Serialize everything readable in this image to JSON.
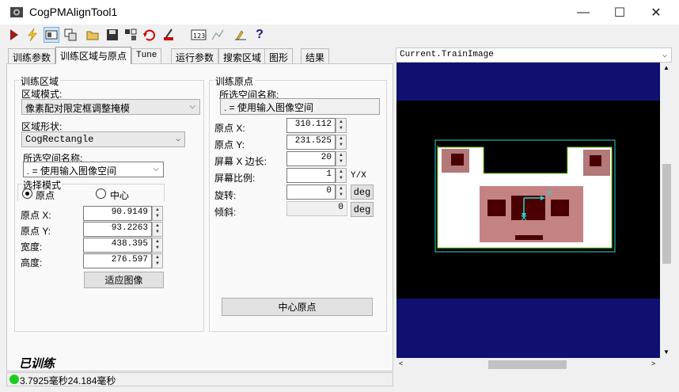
{
  "window": {
    "title": "CogPMAlignTool1",
    "min_glyph": "—",
    "max_glyph": "☐",
    "close_glyph": "✕"
  },
  "tabs": [
    {
      "label": "训练参数"
    },
    {
      "label": "训练区域与原点"
    },
    {
      "label": "Tune"
    },
    {
      "label": "运行参数"
    },
    {
      "label": "搜索区域"
    },
    {
      "label": "图形"
    },
    {
      "label": "结果"
    }
  ],
  "region": {
    "group_title": "训练区域",
    "mode_label": "区域模式:",
    "mode_value": "像素配对限定框调整掩模",
    "shape_label": "区域形状:",
    "shape_value": "CogRectangle",
    "space_label": "所选空间名称:",
    "space_value": ". = 使用输入图像空间",
    "select_mode_title": "选择模式",
    "radio_origin": "原点",
    "radio_center": "中心",
    "origin_x_label": "原点 X:",
    "origin_x": "90.9149",
    "origin_y_label": "原点 Y:",
    "origin_y": "93.2263",
    "width_label": "宽度:",
    "width": "438.395",
    "height_label": "高度:",
    "height": "276.597",
    "fit_button": "适应图像"
  },
  "origin": {
    "group_title": "训练原点",
    "space_label": "所选空间名称:",
    "space_value": ". = 使用输入图像空间",
    "x_label": "原点 X:",
    "x": "310.112",
    "y_label": "原点 Y:",
    "y": "231.525",
    "screen_x_label": "屏幕 X 边长:",
    "screen_x": "20",
    "screen_ratio_label": "屏幕比例:",
    "screen_ratio": "1",
    "ratio_unit": "Y/X",
    "rotation_label": "旋转:",
    "rotation": "0",
    "skew_label": "倾斜:",
    "skew": "0",
    "deg": "deg",
    "center_button": "中心原点"
  },
  "image": {
    "header": "Current.TrainImage"
  },
  "status": {
    "trained": "已训练",
    "timing": "3.7925毫秒24.184毫秒"
  }
}
